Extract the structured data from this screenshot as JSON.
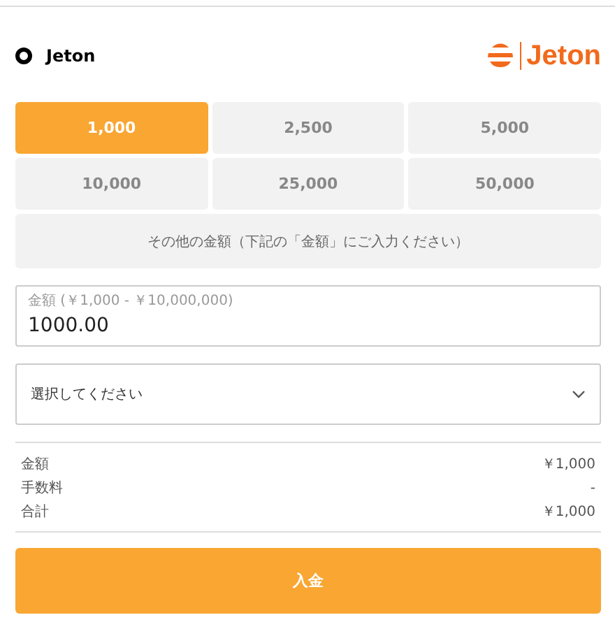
{
  "payment_method": {
    "label": "Jeton",
    "selected": true,
    "logo_text": "Jeton"
  },
  "amount_options": [
    {
      "label": "1,000",
      "selected": true
    },
    {
      "label": "2,500",
      "selected": false
    },
    {
      "label": "5,000",
      "selected": false
    },
    {
      "label": "10,000",
      "selected": false
    },
    {
      "label": "25,000",
      "selected": false
    },
    {
      "label": "50,000",
      "selected": false
    }
  ],
  "other_amount": {
    "label": "その他の金額（下記の「金額」にご入力ください）",
    "selected": false
  },
  "amount_field": {
    "label": "金額 (￥1,000 - ￥10,000,000)",
    "value": "1000.00"
  },
  "select": {
    "placeholder": "選択してください"
  },
  "summary": [
    {
      "label": "金額",
      "value": "￥1,000"
    },
    {
      "label": "手数料",
      "value": "-"
    },
    {
      "label": "合計",
      "value": "￥1,000"
    }
  ],
  "submit": {
    "label": "入金"
  }
}
